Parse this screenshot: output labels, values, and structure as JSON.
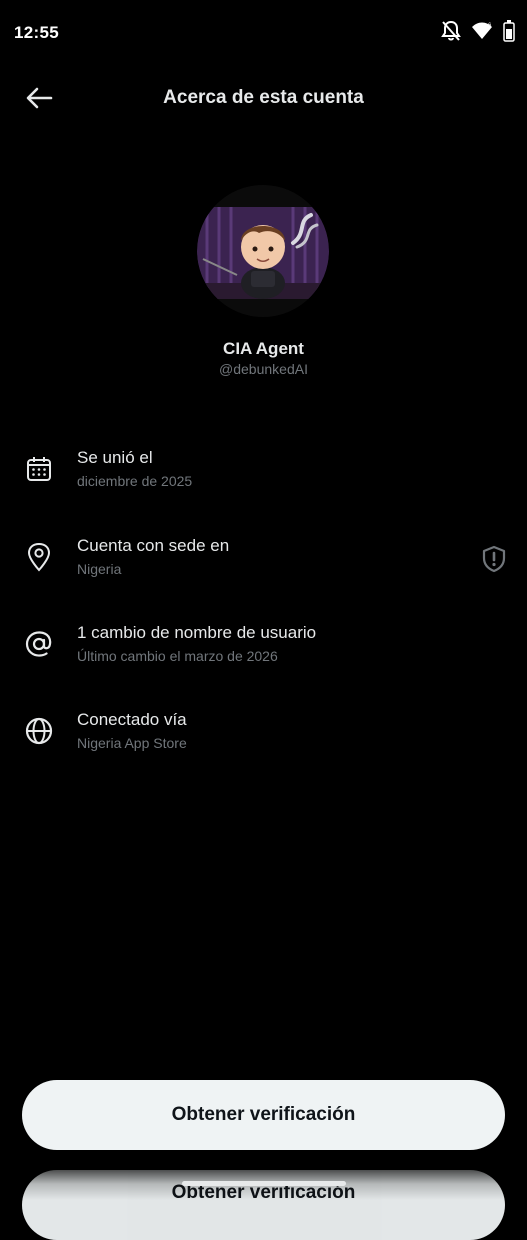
{
  "status_bar": {
    "time": "12:55",
    "icons": [
      "bell-off-icon",
      "wifi-icon",
      "battery-icon"
    ]
  },
  "header": {
    "title": "Acerca de esta cuenta",
    "back_icon": "arrow-left-icon"
  },
  "profile": {
    "display_name": "CIA Agent",
    "handle": "@debunkedAI",
    "avatar_icon": "avatar-image"
  },
  "info_rows": [
    {
      "icon": "calendar-icon",
      "title": "Se unió el",
      "subtitle": "diciembre de 2025"
    },
    {
      "icon": "location-pin-icon",
      "title": "Cuenta con sede en",
      "subtitle": "Nigeria",
      "side_icon": "shield-alert-icon"
    },
    {
      "icon": "at-sign-icon",
      "title": "1 cambio de nombre de usuario",
      "subtitle": "Último cambio el marzo de 2026"
    },
    {
      "icon": "globe-icon",
      "title": "Conectado vía",
      "subtitle": "Nigeria App Store"
    }
  ],
  "actions": {
    "verify_label": "Obtener verificación",
    "verify_label_ghost": "Obtener verificación"
  },
  "colors": {
    "background": "#000000",
    "primary_text": "#e7e9ea",
    "secondary_text": "#71767b",
    "button_bg": "#eff3f4",
    "button_text": "#0f1419"
  }
}
